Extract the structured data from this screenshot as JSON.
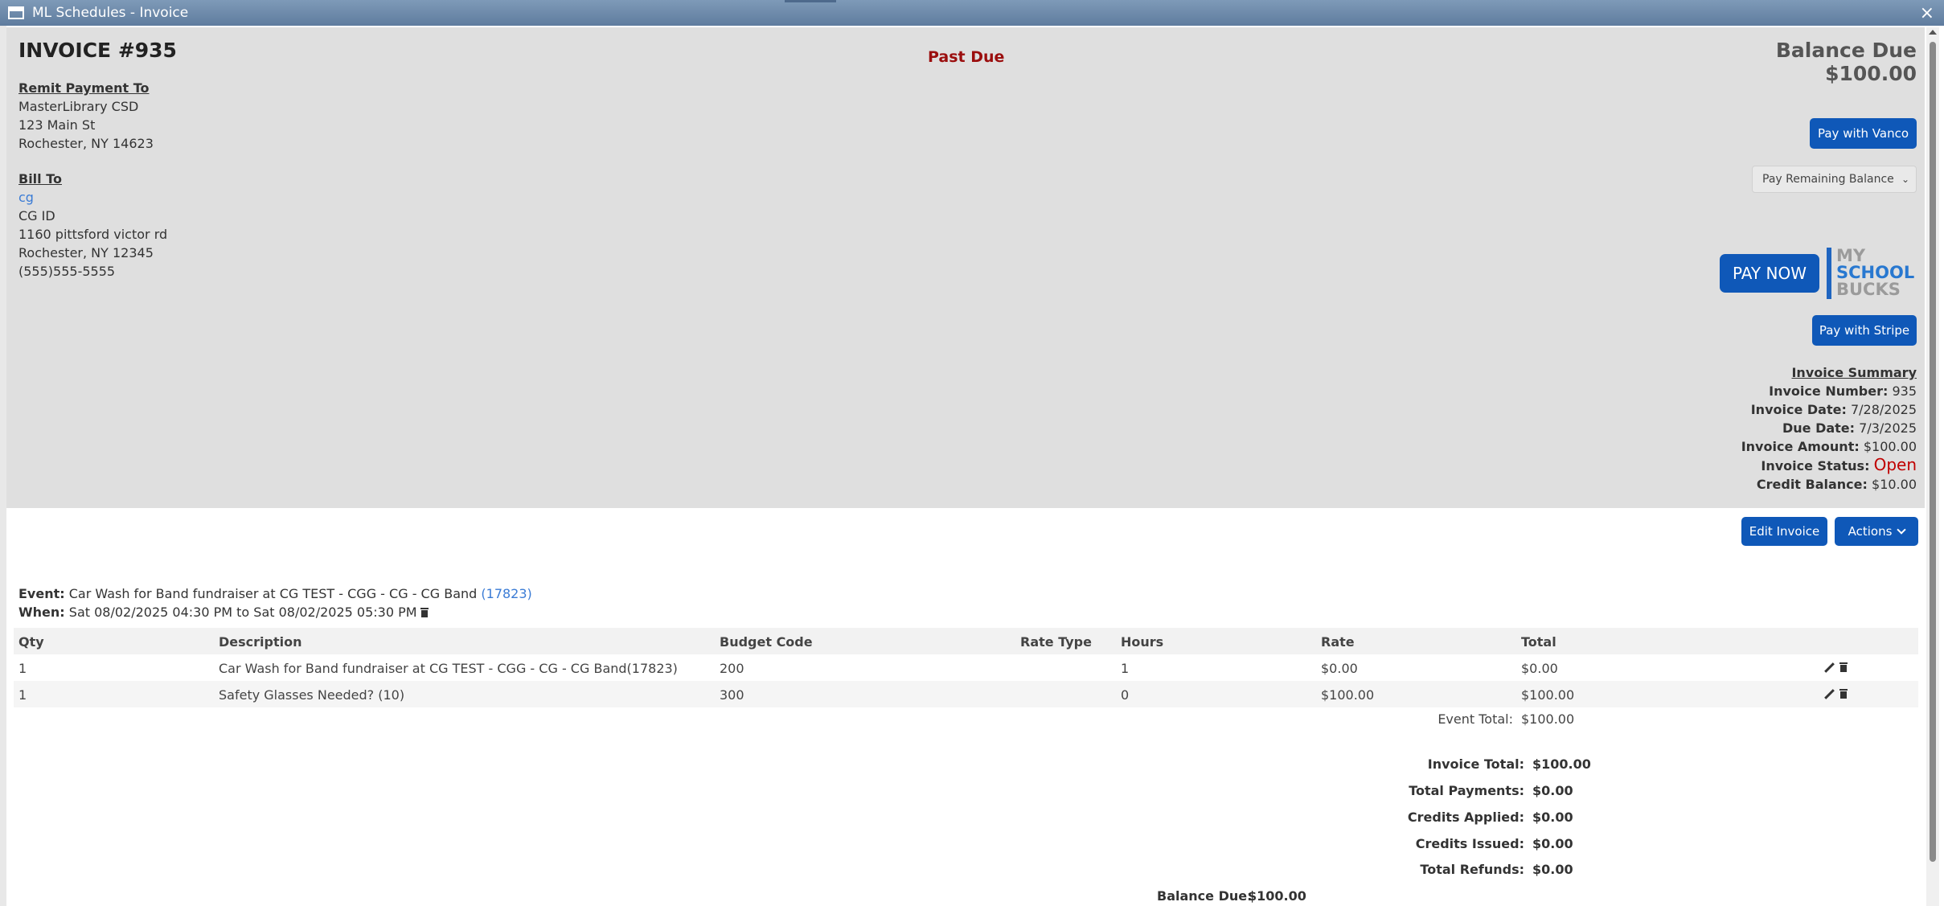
{
  "window": {
    "title": "ML Schedules - Invoice",
    "close_label": "×"
  },
  "header": {
    "invoice_title": "INVOICE #935",
    "status_banner": "Past Due",
    "balance_due_label": "Balance Due",
    "balance_due_amount": "$100.00"
  },
  "remit": {
    "heading": "Remit Payment To",
    "lines": [
      "MasterLibrary CSD",
      "123 Main St",
      "Rochester, NY 14623"
    ]
  },
  "bill_to": {
    "heading": "Bill To",
    "name_link": "cg",
    "lines": [
      "CG ID",
      "1160 pittsford victor rd",
      "Rochester, NY 12345",
      "(555)555-5555"
    ]
  },
  "payment": {
    "vanco_label": "Pay with Vanco",
    "amount_option": "Pay Remaining Balance",
    "pay_now_label": "PAY NOW",
    "msb_logo": [
      "MY",
      "SCHOOL",
      "BUCKS"
    ],
    "stripe_label": "Pay with Stripe"
  },
  "summary": {
    "heading": "Invoice Summary",
    "rows": [
      {
        "label": "Invoice Number:",
        "value": "935"
      },
      {
        "label": "Invoice Date:",
        "value": "7/28/2025"
      },
      {
        "label": "Due Date:",
        "value": "7/3/2025"
      },
      {
        "label": "Invoice Amount:",
        "value": "$100.00"
      },
      {
        "label": "Invoice Status:",
        "value": "Open"
      },
      {
        "label": "Credit Balance:",
        "value": "$10.00"
      }
    ]
  },
  "toolbar": {
    "edit_label": "Edit Invoice",
    "actions_label": "Actions"
  },
  "event": {
    "event_label": "Event:",
    "event_text": "Car Wash for Band fundraiser at CG TEST - CGG - CG - CG Band",
    "event_id": "(17823)",
    "when_label": "When:",
    "when_text": "Sat 08/02/2025 04:30 PM to Sat 08/02/2025 05:30 PM"
  },
  "table": {
    "columns": [
      "Qty",
      "Description",
      "Budget Code",
      "Rate Type",
      "Hours",
      "Rate",
      "Total"
    ],
    "rows": [
      {
        "qty": "1",
        "description": "Car Wash for Band fundraiser at CG TEST - CGG - CG - CG Band(17823)",
        "budget": "200",
        "rate_type": "",
        "hours": "1",
        "rate": "$0.00",
        "total": "$0.00"
      },
      {
        "qty": "1",
        "description": "Safety Glasses Needed? (10)",
        "budget": "300",
        "rate_type": "",
        "hours": "0",
        "rate": "$100.00",
        "total": "$100.00"
      }
    ],
    "event_total_label": "Event Total:",
    "event_total_value": "$100.00"
  },
  "totals": [
    {
      "label": "Invoice Total:",
      "value": "$100.00"
    },
    {
      "label": "Total Payments:",
      "value": "$0.00"
    },
    {
      "label": "Credits Applied:",
      "value": "$0.00"
    },
    {
      "label": "Credits Issued:",
      "value": "$0.00"
    },
    {
      "label": "Total Refunds:",
      "value": "$0.00"
    }
  ],
  "balance": {
    "label": "Balance Due:",
    "value": "$100.00"
  }
}
